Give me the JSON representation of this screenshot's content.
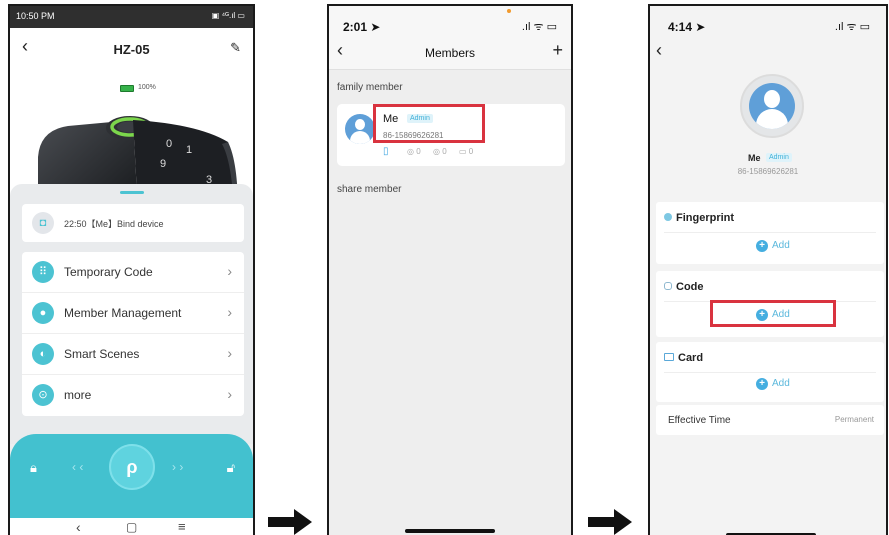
{
  "screen1": {
    "status": {
      "time": "10:50 PM",
      "signal": "▣ ⁴ᴳ.ıl ▭"
    },
    "title": "HZ-05",
    "battery": "100%",
    "keypad_digits": [
      "0",
      "1",
      "9",
      "3"
    ],
    "notice": "22:50【Me】Bind device",
    "menu": [
      {
        "label": "Temporary Code",
        "icon": "grid-icon"
      },
      {
        "label": "Member Management",
        "icon": "person-icon"
      },
      {
        "label": "Smart Scenes",
        "icon": "toggle-icon"
      },
      {
        "label": "more",
        "icon": "more-icon"
      }
    ],
    "unlock_glyph": "ρ",
    "slide_left": "‹ ‹",
    "slide_right": "› ›",
    "nav": {
      "back": "‹",
      "home": "▢",
      "menu": "≡"
    }
  },
  "screen2": {
    "status": {
      "time": "2:01 ➤",
      "signal": ".ıl ᯤ ▭"
    },
    "back": "‹",
    "title": "Members",
    "add": "+",
    "section_family": "family member",
    "member": {
      "name": "Me",
      "role": "Admin",
      "phone": "86-15869626281",
      "counts": [
        "0",
        "0",
        "0"
      ]
    },
    "section_share": "share member"
  },
  "screen3": {
    "status": {
      "time": "4:14 ➤",
      "signal": ".ıl ᯤ ▭"
    },
    "back": "‹",
    "name": "Me",
    "role": "Admin",
    "phone": "86-15869626281",
    "sections": [
      {
        "title": "Fingerprint",
        "add": "Add"
      },
      {
        "title": "Code",
        "add": "Add"
      },
      {
        "title": "Card",
        "add": "Add"
      }
    ],
    "effective_label": "Effective Time",
    "effective_value": "Permanent"
  },
  "colors": {
    "accent": "#43c1cf",
    "highlight": "#d9333f",
    "avatar": "#5f9fd8"
  }
}
